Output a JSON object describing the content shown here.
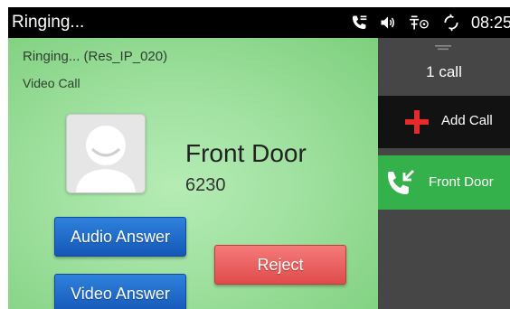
{
  "status_bar": {
    "title": "Ringing...",
    "time": "08:25",
    "icons": [
      "phone-icon",
      "speaker-icon",
      "usb-icon",
      "sync-icon"
    ]
  },
  "call": {
    "state": "Ringing... (Res_IP_020)",
    "type": "Video Call",
    "contact_name": "Front Door",
    "contact_number": "6230"
  },
  "actions": {
    "audio_answer": "Audio Answer",
    "video_answer": "Video Answer",
    "reject": "Reject"
  },
  "side_panel": {
    "call_count": "1 call",
    "add_call": "Add Call",
    "calls": [
      {
        "label": "Front Door"
      }
    ]
  },
  "colors": {
    "main_background": "#a7e4a7",
    "active_call": "#34b14a",
    "answer_button": "#1f6fcf",
    "reject_button": "#ec6262",
    "add_call_plus": "#e62b2b"
  }
}
